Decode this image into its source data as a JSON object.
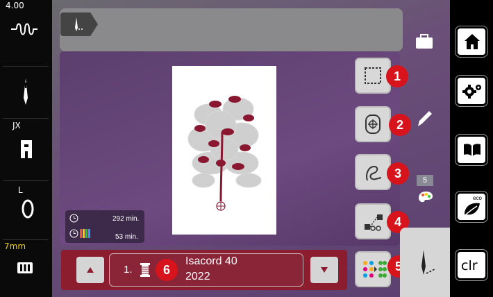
{
  "left_bar": {
    "stitch_width": "4.00",
    "presser_foot_label": "JX",
    "foot_type_label": "L",
    "stitch_length": "7mm"
  },
  "design_info": {
    "total_time": "292 min.",
    "color_time": "53 min."
  },
  "tool_buttons": [
    {
      "icon": "select-frame-icon",
      "number": "1"
    },
    {
      "icon": "move-hoop-icon",
      "number": "2"
    },
    {
      "icon": "stitch-trace-icon",
      "number": "3"
    },
    {
      "icon": "cut-connector-icon",
      "number": "4"
    },
    {
      "icon": "color-sequence-icon",
      "number": "5"
    }
  ],
  "side": {
    "color_count": "5"
  },
  "color_bar": {
    "index": "1.",
    "number_marker": "6",
    "thread_name": "Isacord 40",
    "thread_code": "2022"
  },
  "right_bar": {
    "eco_label": "eco",
    "clr_label": "clr"
  },
  "colors": {
    "accent_red": "#d7141c",
    "design_red": "#8a1730",
    "bar_red": "#8c1d2f"
  }
}
